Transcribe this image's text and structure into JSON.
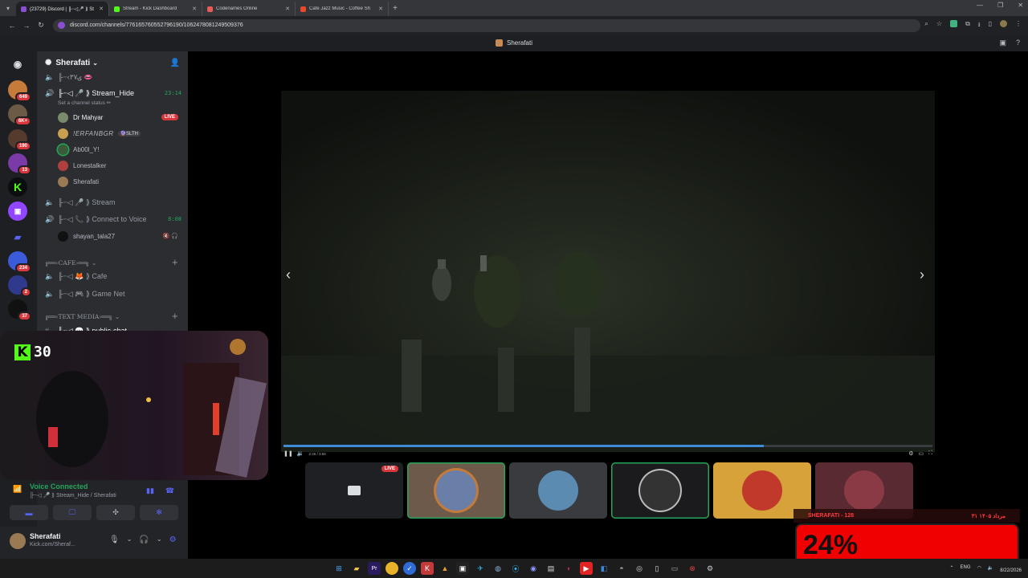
{
  "browser": {
    "tabs": [
      {
        "title": "(23729) Discord | ╟┈◁🎤 ⟫ St",
        "color": "#8a4fd1",
        "active": true
      },
      {
        "title": "Stream - Kick Dashboard",
        "color": "#53fc18",
        "active": false
      },
      {
        "title": "Codenames Online",
        "color": "#e85b5b",
        "active": false
      },
      {
        "title": "Cafe Jazz Music - Coffee Sh",
        "color": "#e84a2b",
        "active": false
      }
    ],
    "url": "discord.com/channels/776165760552796190/1062478081249509376",
    "new_tab": "+"
  },
  "discord": {
    "title": "Sherafati",
    "guild": {
      "name": "Sherafati",
      "channels": {
        "top_partial": "╟┈‹ۍ٣٧ 👄",
        "stream_hide": {
          "name": "╟┈◁ 🎤 ⟫ Stream_Hide",
          "time": "23:14",
          "status": "Set a channel status ✏"
        },
        "members": [
          {
            "name": "Dr Mahyar",
            "live": "LIVE",
            "color": "#7a8a6a"
          },
          {
            "name": "!ERFANBGR",
            "tag": "🔮SLTH",
            "color": "#c9a050"
          },
          {
            "name": "Ab00l_Y!",
            "color": "#3a5a3a"
          },
          {
            "name": "Lonestalker",
            "color": "#b04040"
          },
          {
            "name": "Sherafati",
            "color": "#9a7a55"
          }
        ],
        "stream": {
          "name": "╟┈◁ 🎤 ⟫ Stream"
        },
        "connect": {
          "name": "╟┈◁ 📞 ⟫ Connect to Voice",
          "time": "8:08"
        },
        "shayan": {
          "name": "shayan_tala27",
          "icons": "🔇 🎧"
        },
        "cafe_cat": "╔══‹CAFE›══╗",
        "cafe": {
          "name": "╟┈◁ 🦊 ⟫ Cafe"
        },
        "gamenet": {
          "name": "╟┈◁ 🎮 ⟫ Game Net"
        },
        "text_cat": "╔══‹TEXT MEDIA›══╗",
        "public_chat": "╟┈◁ 💬 ⟫ public-chat"
      }
    },
    "rail_badges": [
      "649",
      "6K+",
      "190",
      "13",
      "234",
      "2",
      "37"
    ],
    "voice": {
      "label": "Voice Connected",
      "sub": "╟┈◁ 🎤 ⟫ Stream_Hide / Sherafati"
    },
    "user": {
      "name": "Sherafati",
      "sub": "Kick.com/Sheraf..."
    }
  },
  "player": {
    "time": "2:26 / 3:56",
    "progress": 0.74
  },
  "tiles": [
    {
      "type": "screen",
      "live": "LIVE"
    },
    {
      "type": "avatar",
      "color": "#6a7fa8",
      "speaking": true
    },
    {
      "type": "avatar",
      "color": "#5b8bb0"
    },
    {
      "type": "avatar",
      "color": "#444",
      "speaking": true
    },
    {
      "type": "avatar",
      "color": "#d7a23a"
    },
    {
      "type": "avatar",
      "color": "#8a3a45"
    }
  ],
  "webcam": {
    "kick_number": "30"
  },
  "overlay": {
    "strip_left": "SHERAFATI - 128",
    "strip_right": "۳۱ مرداد ۱۴۰۵",
    "percent": "24%"
  },
  "taskbar": {
    "lang": "ENG",
    "time": "",
    "date": "8/22/2026"
  }
}
